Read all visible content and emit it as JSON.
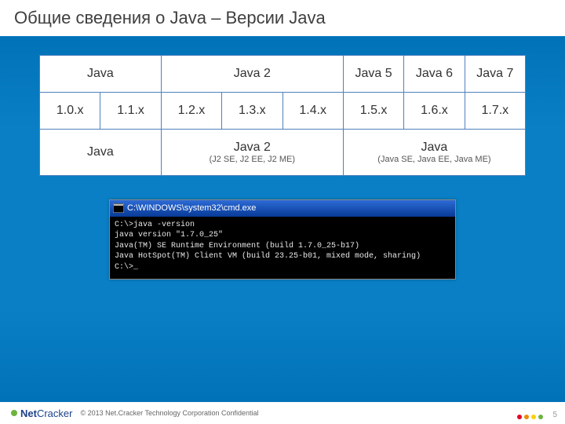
{
  "title": "Общие сведения о Java – Версии Java",
  "table": {
    "row1": {
      "c0": "Java",
      "c1": "Java 2",
      "c2": "Java 5",
      "c3": "Java 6",
      "c4": "Java 7"
    },
    "row2": {
      "c0": "1.0.x",
      "c1": "1.1.x",
      "c2": "1.2.x",
      "c3": "1.3.x",
      "c4": "1.4.x",
      "c5": "1.5.x",
      "c6": "1.6.x",
      "c7": "1.7.x"
    },
    "row3": {
      "c0": "Java",
      "c1_top": "Java 2",
      "c1_sub": "(J2 SE, J2 EE, J2 ME)",
      "c2_top": "Java",
      "c2_sub": "(Java SE, Java EE, Java ME)"
    }
  },
  "cmd": {
    "window_title": "C:\\WINDOWS\\system32\\cmd.exe",
    "lines": [
      "C:\\>java -version",
      "java version \"1.7.0_25\"",
      "Java(TM) SE Runtime Environment (build 1.7.0_25-b17)",
      "Java HotSpot(TM) Client VM (build 23.25-b01, mixed mode, sharing)",
      "",
      "C:\\>_"
    ]
  },
  "footer": {
    "logo_main": "Net",
    "logo_thin": "Cracker",
    "copyright": "© 2013 Net.Cracker Technology Corporation Confidential",
    "slide_number": "5"
  },
  "dots": [
    "#e4002b",
    "#ed8b00",
    "#ffd100",
    "#6db33f"
  ]
}
